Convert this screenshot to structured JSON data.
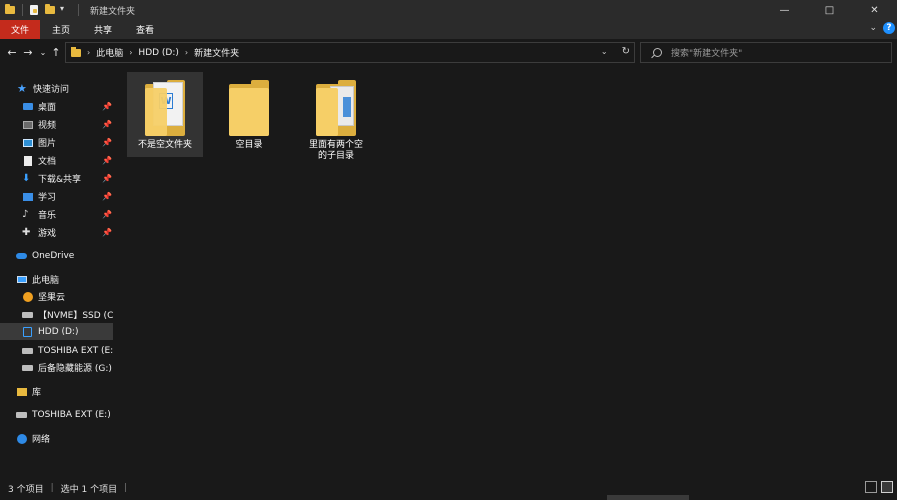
{
  "window": {
    "title": "新建文件夹",
    "controls": {
      "minimize": "—",
      "maximize": "□",
      "close": "✕"
    }
  },
  "ribbon": {
    "tabs": [
      "文件",
      "主页",
      "共享",
      "查看"
    ],
    "expand_icon": "chevron-down-icon",
    "help": "?"
  },
  "nav": {
    "breadcrumb": [
      "此电脑",
      "HDD (D:)",
      "新建文件夹"
    ],
    "search_placeholder": "搜索\"新建文件夹\""
  },
  "sidebar": {
    "quick_access": "快速访问",
    "pinned": [
      {
        "label": "桌面",
        "icon": "desktop-icon"
      },
      {
        "label": "视频",
        "icon": "video-icon"
      },
      {
        "label": "图片",
        "icon": "pictures-icon"
      },
      {
        "label": "文档",
        "icon": "documents-icon"
      },
      {
        "label": "下载&共享",
        "icon": "download-icon"
      },
      {
        "label": "学习",
        "icon": "study-folder-icon"
      },
      {
        "label": "音乐",
        "icon": "music-icon"
      },
      {
        "label": "游戏",
        "icon": "game-icon"
      }
    ],
    "onedrive": "OneDrive",
    "this_pc": "此电脑",
    "drives": [
      {
        "label": "坚果云",
        "icon": "nutstore-icon"
      },
      {
        "label": "【NVME】SSD (C:",
        "icon": "drive-icon"
      },
      {
        "label": "HDD (D:)",
        "icon": "hdd-icon"
      },
      {
        "label": "TOSHIBA EXT (E:)",
        "icon": "drive-icon"
      },
      {
        "label": "后备隐藏能源 (G:)",
        "icon": "drive-icon"
      }
    ],
    "library": "库",
    "toshiba": "TOSHIBA EXT (E:)",
    "network": "网络"
  },
  "files": [
    {
      "name": "不是空文件夹",
      "selected": true
    },
    {
      "name": "空目录",
      "selected": false
    },
    {
      "name": "里面有两个空的子目录",
      "selected": false
    }
  ],
  "status": {
    "count": "3 个项目",
    "selected": "选中 1 个项目"
  },
  "colors": {
    "accent_file_tab": "#c42b1c",
    "folder": "#f6cf67",
    "background": "#191919"
  }
}
